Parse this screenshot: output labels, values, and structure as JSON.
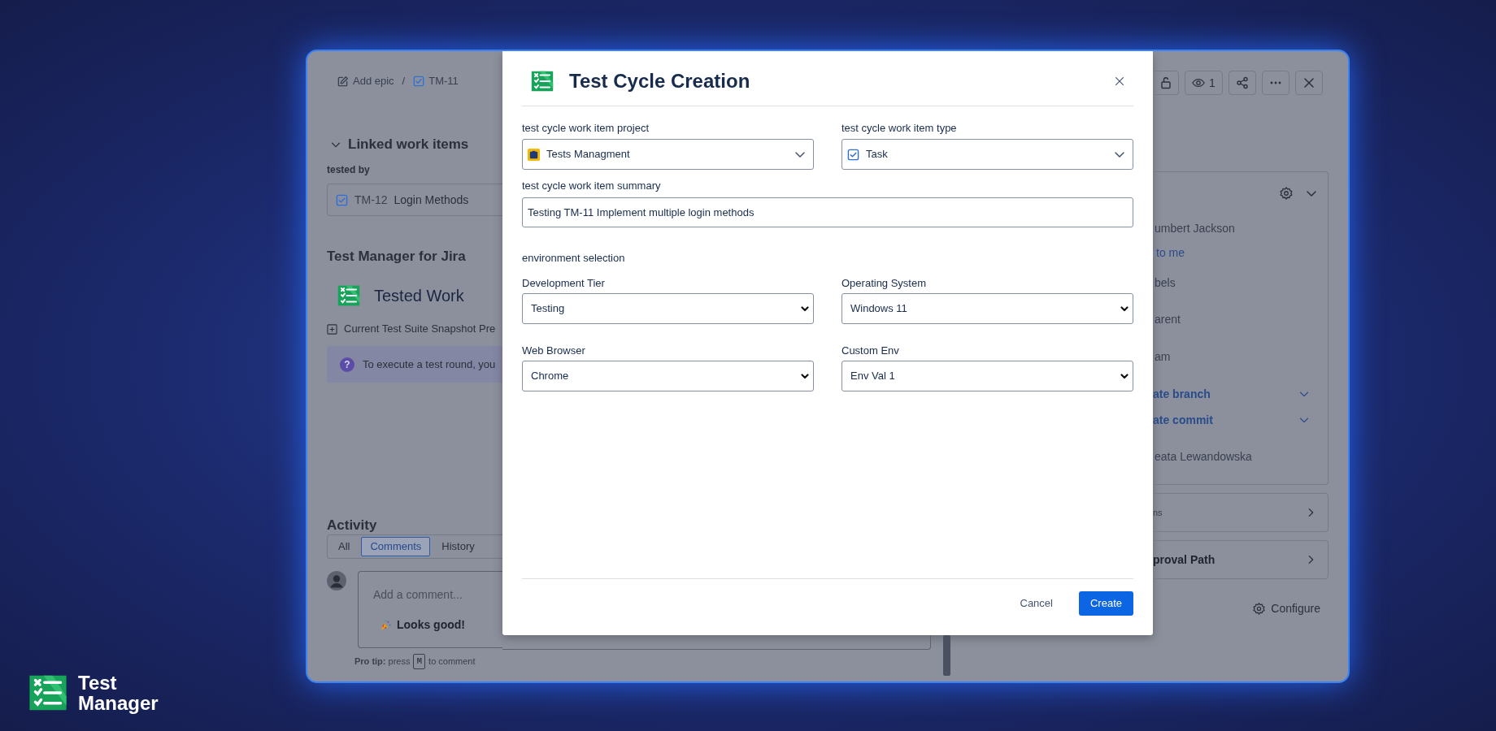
{
  "brand": {
    "line_1": "Test",
    "line_2": "Manager"
  },
  "issue": {
    "breadcrumb": [
      {
        "kind": "epic",
        "label": "Add epic"
      },
      {
        "kind": "task",
        "label": "TM-11"
      }
    ],
    "separator": "/",
    "linked_items": {
      "title": "Linked work items",
      "expanded": true,
      "relation": "tested by",
      "items": [
        {
          "key": "TM-12",
          "summary": "Login Methods"
        }
      ]
    },
    "app_panel": {
      "title": "Test Manager for Jira",
      "heading": "Tested Work",
      "snapshot": "Current Test Suite Snapshot Pre",
      "info_icon": "?",
      "info": "To execute a test round, you"
    },
    "activity": {
      "title": "Activity",
      "tabs": [
        {
          "label": "All",
          "selected": false
        },
        {
          "label": "Comments",
          "selected": true
        },
        {
          "label": "History",
          "selected": false
        }
      ],
      "comment_placeholder": "Add a comment...",
      "quick_reply": "Looks good!",
      "pro_tip": "**Pro tip:** press",
      "pro_tip_key": "M",
      "pro_tip_end": "to comment"
    }
  },
  "toolbar": [
    {
      "kind": "lock"
    },
    {
      "kind": "watch",
      "count": "1"
    },
    {
      "kind": "share"
    },
    {
      "kind": "more"
    },
    {
      "kind": "close"
    }
  ],
  "details": {
    "rows": [
      {
        "kind": "text",
        "label": "umbert Jackson"
      },
      {
        "kind": "link",
        "label": "to me"
      },
      {
        "kind": "text",
        "label": "bels"
      },
      {
        "kind": "text",
        "label": "arent"
      },
      {
        "kind": "text",
        "label": "am"
      },
      {
        "kind": "dev",
        "label": "ate branch"
      },
      {
        "kind": "dev",
        "label": "ate commit"
      },
      {
        "kind": "text",
        "label": "eata Lewandowska"
      }
    ]
  },
  "sections": [
    {
      "kind": "muted",
      "label": "ns"
    },
    {
      "kind": "bold",
      "label": "proval Path"
    }
  ],
  "configure": "Configure",
  "dialog": {
    "title": "Test Cycle Creation",
    "project": {
      "label": "test cycle work item project",
      "value": "Tests Managment"
    },
    "type": {
      "label": "test cycle work item type",
      "value": "Task"
    },
    "summary": {
      "label": "test cycle work item summary",
      "value": "Testing TM-11 Implement multiple login methods"
    },
    "environment": {
      "heading": "environment selection",
      "selects": [
        {
          "label": "Development Tier",
          "value": "Testing"
        },
        {
          "label": "Operating System",
          "value": "Windows 11"
        },
        {
          "label": "Web Browser",
          "value": "Chrome"
        },
        {
          "label": "Custom Env",
          "value": "Env Val 1"
        }
      ]
    },
    "buttons": [
      {
        "kind": "subtle",
        "label": "Cancel"
      },
      {
        "kind": "primary",
        "label": "Create"
      }
    ]
  }
}
